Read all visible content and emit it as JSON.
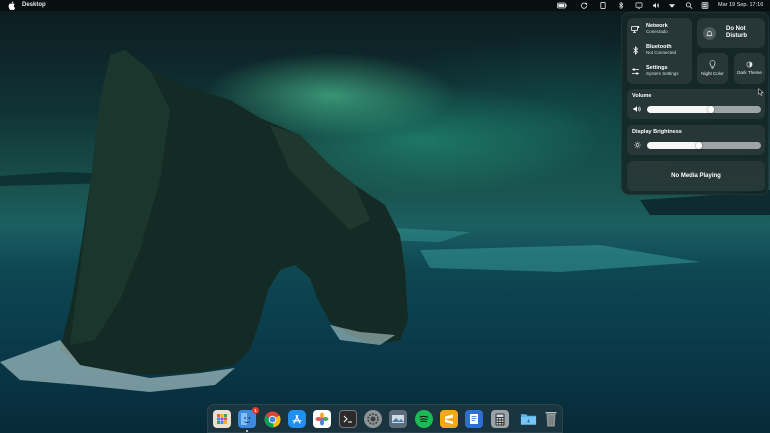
{
  "menubar": {
    "app_name": "Desktop",
    "clock": "Mar 19 Sep. 17:16",
    "icons": [
      "battery-icon",
      "refresh-icon",
      "tablet-icon",
      "bluetooth-icon",
      "display-icon",
      "volume-icon",
      "wifi-icon",
      "search-icon",
      "control-center-icon"
    ]
  },
  "control_center": {
    "network": {
      "title": "Network",
      "subtitle": "Conectado"
    },
    "bluetooth": {
      "title": "Bluetooth",
      "subtitle": "Not Connected"
    },
    "settings": {
      "title": "Settings",
      "subtitle": "System Settings"
    },
    "do_not_disturb": {
      "label": "Do Not Disturb"
    },
    "night_color": {
      "label": "Night Color"
    },
    "dark_theme": {
      "label": "Dark Theme"
    },
    "volume": {
      "title": "Volume",
      "level_percent": 56
    },
    "brightness": {
      "title": "Display Brightness",
      "level_percent": 46
    },
    "media": {
      "status": "No Media Playing"
    }
  },
  "dock": {
    "items": [
      {
        "name": "launchpad",
        "color": "#e9e0d0"
      },
      {
        "name": "finder",
        "color": "#3d8be0",
        "badge": "1"
      },
      {
        "name": "chrome",
        "color": "#ffffff"
      },
      {
        "name": "app-store",
        "color": "#1f8ff0"
      },
      {
        "name": "photos",
        "color": "#ffffff"
      },
      {
        "name": "terminal",
        "color": "#2b2b2b"
      },
      {
        "name": "system-preferences",
        "color": "#8e9396"
      },
      {
        "name": "preview",
        "color": "#5d6c7a"
      },
      {
        "name": "spotify",
        "color": "#1db954"
      },
      {
        "name": "sublime-text",
        "color": "#f7a51a"
      },
      {
        "name": "text-editor",
        "color": "#2f6fd1"
      },
      {
        "name": "calculator",
        "color": "#9aa2a6"
      },
      {
        "name": "downloads-folder",
        "color": "#5ab6ee"
      },
      {
        "name": "trash",
        "color": "#8b9396"
      }
    ]
  },
  "colors": {
    "accent": "#1b5f62",
    "panel": "#16262a"
  }
}
